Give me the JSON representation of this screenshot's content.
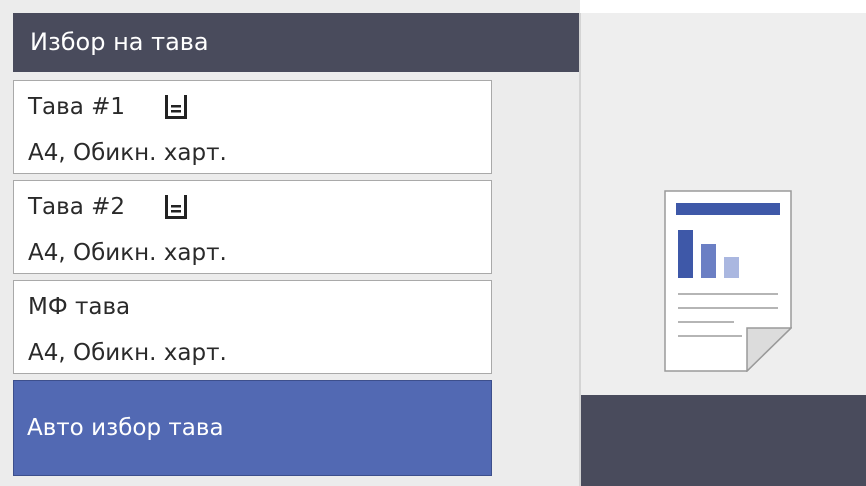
{
  "header": {
    "title": "Избор на тава"
  },
  "trays": [
    {
      "name": "Тава #1",
      "paper": "A4, Обикн. харт.",
      "icon": "tray-paper-icon"
    },
    {
      "name": "Тава #2",
      "paper": "A4, Обикн. харт.",
      "icon": "tray-paper-icon"
    },
    {
      "name": "МФ тава",
      "paper": "A4, Обикн. харт."
    }
  ],
  "auto_select": {
    "label": "Авто избор тава",
    "selected": true
  },
  "preview": {
    "icon": "document-preview-icon"
  },
  "colors": {
    "header_bg": "#494b5c",
    "selected_bg": "#5269b3",
    "preview_bar_dark": "#3e58a8",
    "preview_bar_light": "#8fa0d6"
  }
}
